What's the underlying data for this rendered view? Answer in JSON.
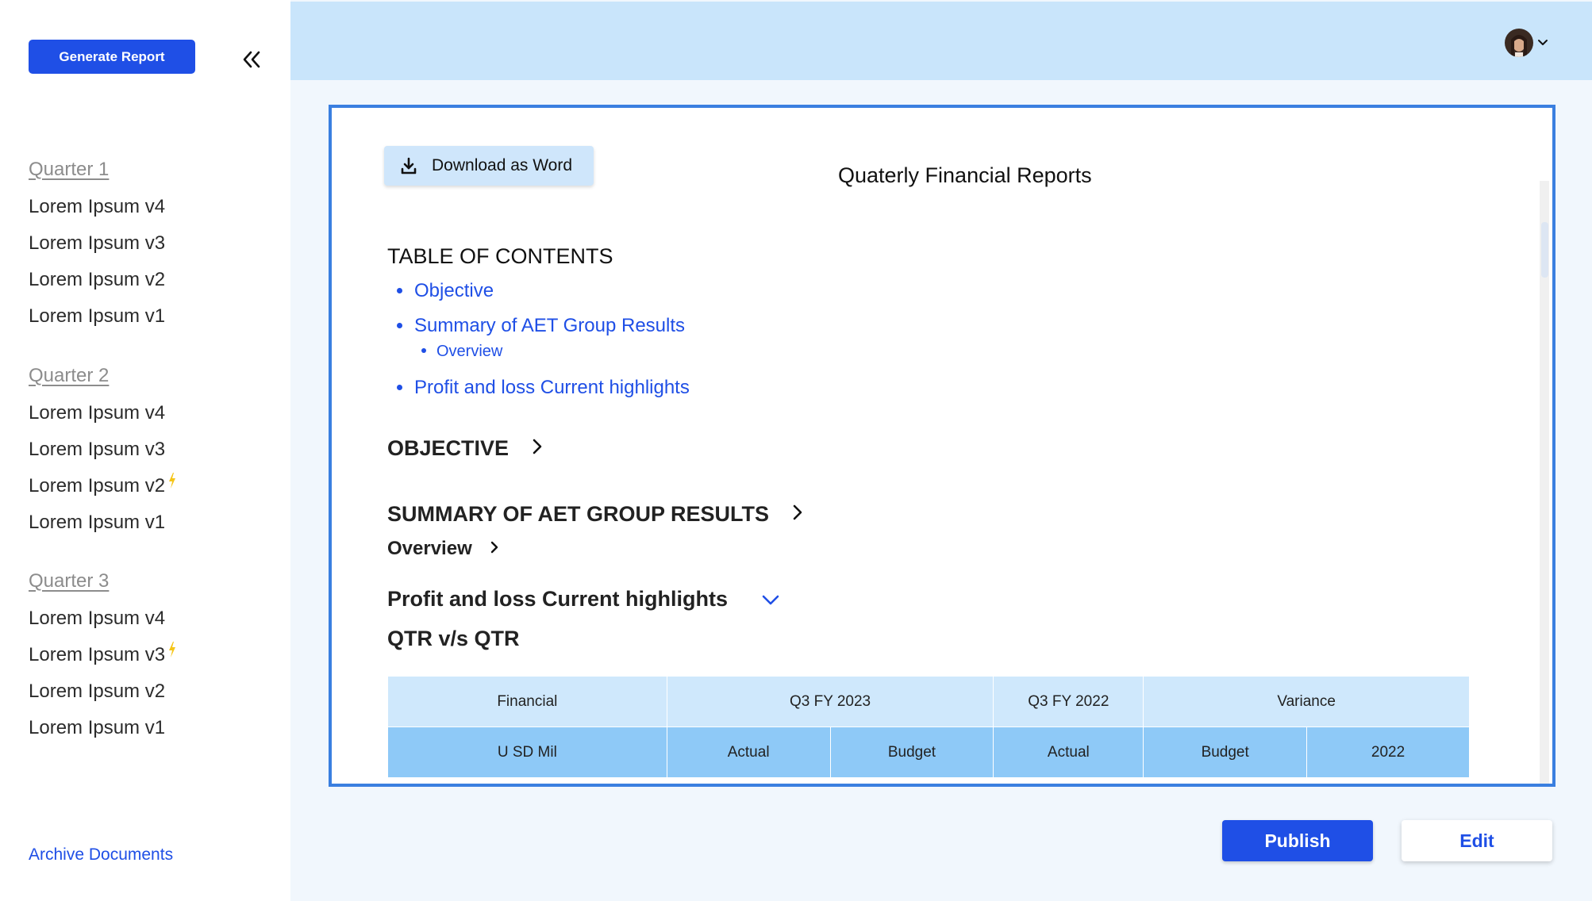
{
  "sidebar": {
    "generate_label": "Generate Report",
    "collapse_icon": "double-chevron-left-icon",
    "quarters": [
      {
        "title": "Quarter 1",
        "items": [
          {
            "label": "Lorem Ipsum v4",
            "flag": false
          },
          {
            "label": "Lorem Ipsum v3",
            "flag": false
          },
          {
            "label": "Lorem Ipsum v2",
            "flag": false
          },
          {
            "label": "Lorem Ipsum v1",
            "flag": false
          }
        ]
      },
      {
        "title": "Quarter 2",
        "items": [
          {
            "label": "Lorem Ipsum v4",
            "flag": false
          },
          {
            "label": "Lorem Ipsum v3",
            "flag": false
          },
          {
            "label": "Lorem Ipsum v2",
            "flag": true
          },
          {
            "label": "Lorem Ipsum v1",
            "flag": false
          }
        ]
      },
      {
        "title": "Quarter 3",
        "items": [
          {
            "label": "Lorem Ipsum v4",
            "flag": false
          },
          {
            "label": "Lorem Ipsum v3",
            "flag": true
          },
          {
            "label": "Lorem Ipsum v2",
            "flag": false
          },
          {
            "label": "Lorem Ipsum v1",
            "flag": false
          }
        ]
      }
    ],
    "archive_label": "Archive Documents"
  },
  "header": {
    "avatar_icon": "user-avatar",
    "menu_icon": "chevron-down-icon"
  },
  "document": {
    "download_label": "Download as Word",
    "title": "Quaterly Financial Reports",
    "toc": {
      "heading": "TABLE OF CONTENTS",
      "items": [
        "Objective",
        "Summary of AET Group Results"
      ],
      "sub_item": "Overview",
      "last_item": "Profit and loss Current highlights"
    },
    "sections": {
      "objective": "OBJECTIVE",
      "summary": "SUMMARY OF AET GROUP RESULTS",
      "overview": "Overview",
      "pl": "Profit and loss Current highlights",
      "qtr": "QTR v/s QTR"
    },
    "table": {
      "header_row": [
        "Financial",
        "Q3 FY 2023",
        "Q3 FY 2022",
        "Variance"
      ],
      "sub_row": [
        "U SD Mil",
        "Actual",
        "Budget",
        "Actual",
        "Budget",
        "2022"
      ]
    }
  },
  "actions": {
    "publish_label": "Publish",
    "edit_label": "Edit"
  },
  "colors": {
    "accent": "#1f4fe6",
    "topbar": "#c9e5fb",
    "panel_border": "#3a7fe0",
    "table_header": "#cfe8fc",
    "table_subheader": "#8ec9f7",
    "flag": "#f5c518"
  }
}
